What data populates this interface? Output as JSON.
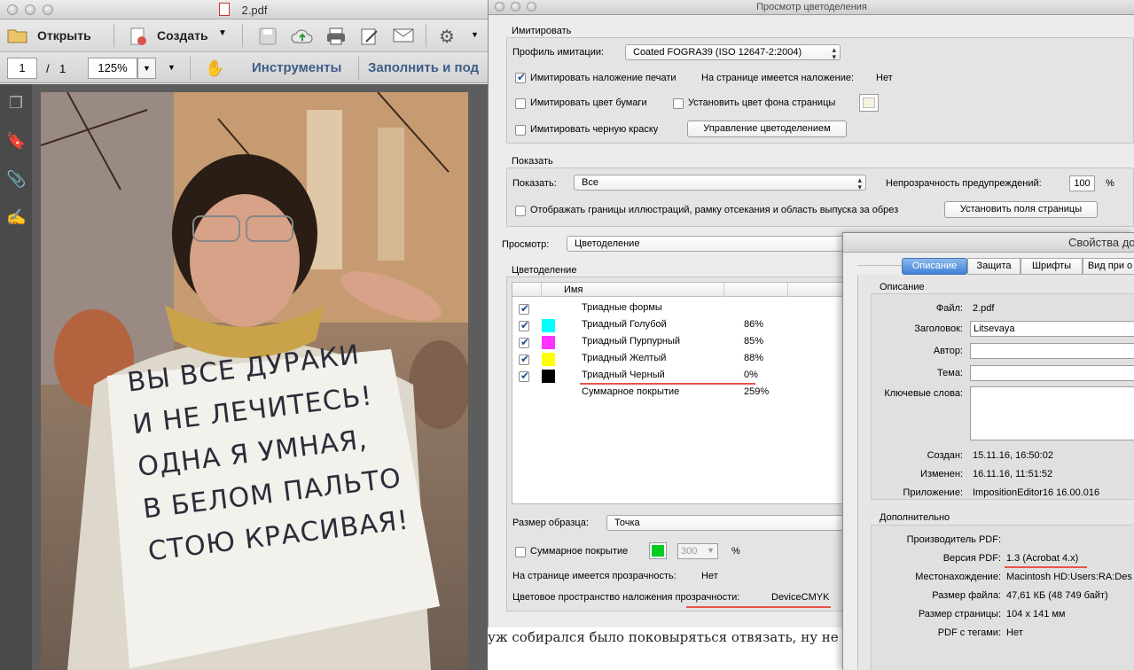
{
  "acrobat": {
    "title": "2.pdf",
    "toolbar": {
      "open_label": "Открыть",
      "create_label": "Создать"
    },
    "nav": {
      "page_current": "1",
      "page_sep": "/",
      "page_total": "1",
      "zoom": "125%",
      "tools_label": "Инструменты",
      "fill_label": "Заполнить и под"
    }
  },
  "photo": {
    "sign_lines": [
      "ВЫ ВСЕ ДУРАКИ",
      "И НЕ ЛЕЧИТЕСЬ!",
      "ОДНА Я УМНАЯ,",
      "В БЕЛОМ ПАЛЬТО",
      "СТОЮ КРАСИВАЯ!"
    ]
  },
  "separation": {
    "title": "Просмотр цветоделения",
    "simulate_group": "Имитировать",
    "profile_label": "Профиль имитации:",
    "profile_value": "Coated FOGRA39 (ISO 12647-2:2004)",
    "sim_overprint": "Имитировать наложение печати",
    "overprint_status_label": "На странице имеется наложение:",
    "overprint_status_value": "Нет",
    "sim_paper": "Имитировать цвет бумаги",
    "set_page_bg": "Установить цвет фона страницы",
    "sim_black": "Имитировать черную краску",
    "manage_button": "Управление цветоделением",
    "show_group": "Показать",
    "show_label": "Показать:",
    "show_value": "Все",
    "warn_opacity_label": "Непрозрачность предупреждений:",
    "warn_opacity_value": "100",
    "percent": "%",
    "show_bounds": "Отображать границы иллюстраций, рамку отсекания и область выпуска за обрез",
    "page_boxes_button": "Установить поля страницы",
    "preview_label": "Просмотр:",
    "preview_value": "Цветоделение",
    "sep_group": "Цветоделение",
    "col_name": "Имя",
    "rows": [
      {
        "name": "Триадные формы",
        "value": "",
        "color": ""
      },
      {
        "name": "Триадный Голубой",
        "value": "86%",
        "color": "#00ffff"
      },
      {
        "name": "Триадный Пурпурный",
        "value": "85%",
        "color": "#ff33ff"
      },
      {
        "name": "Триадный Желтый",
        "value": "88%",
        "color": "#ffff00"
      },
      {
        "name": "Триадный Черный",
        "value": "0%",
        "color": "#000000"
      },
      {
        "name": "Суммарное покрытие",
        "value": "259%",
        "color": ""
      }
    ],
    "sample_size_label": "Размер образца:",
    "sample_size_value": "Точка",
    "total_coverage": "Суммарное покрытие",
    "total_coverage_value": "300",
    "transparency_label": "На странице имеется прозрачность:",
    "transparency_value": "Нет",
    "blend_space_label": "Цветовое пространство наложения прозрачности:",
    "blend_space_value": "DeviceCMYK",
    "accent_color": "#00cc22"
  },
  "props": {
    "title": "Свойства до",
    "tabs": [
      "Описание",
      "Защита",
      "Шрифты",
      "Вид при о"
    ],
    "desc_group": "Описание",
    "file_label": "Файл:",
    "file_value": "2.pdf",
    "title_label": "Заголовок:",
    "title_value": "Litsevaya",
    "author_label": "Автор:",
    "subject_label": "Тема:",
    "keywords_label": "Ключевые слова:",
    "created_label": "Создан:",
    "created_value": "15.11.16, 16:50:02",
    "modified_label": "Изменен:",
    "modified_value": "16.11.16, 11:51:52",
    "app_label": "Приложение:",
    "app_value": "ImpositionEditor16 16.00.016",
    "adv_group": "Дополнительно",
    "producer_label": "Производитель PDF:",
    "version_label": "Версия PDF:",
    "version_value": "1.3 (Acrobat 4.x)",
    "location_label": "Местонахождение:",
    "location_value": "Macintosh HD:Users:RA:Des",
    "filesize_label": "Размер файла:",
    "filesize_value": "47,61 КБ (48 749 байт)",
    "pagesize_label": "Размер страницы:",
    "pagesize_value": "104 x 141 мм",
    "tagged_label": "PDF с тегами:",
    "tagged_value": "Нет"
  },
  "background_text": "уж собирался было поковыряться отвязать, ну не надо"
}
